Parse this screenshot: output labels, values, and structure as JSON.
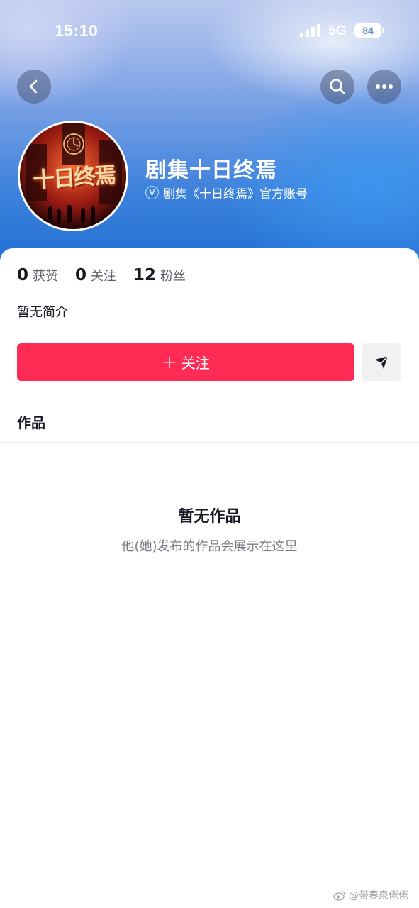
{
  "status_bar": {
    "time": "15:10",
    "network": "5G",
    "battery": "84"
  },
  "header": {
    "back_icon": "chevron-left-icon",
    "search_icon": "search-icon",
    "more_icon": "more-horizontal-icon"
  },
  "profile": {
    "avatar_text": "十日终焉",
    "name": "剧集十日终焉",
    "verified_badge": "V",
    "verified_label": "剧集《十日终焉》官方账号"
  },
  "stats": [
    {
      "value": "0",
      "label": "获赞"
    },
    {
      "value": "0",
      "label": "关注"
    },
    {
      "value": "12",
      "label": "粉丝"
    }
  ],
  "bio": "暂无简介",
  "actions": {
    "follow_plus": "+",
    "follow_label": "关注",
    "message_icon": "send-icon"
  },
  "tabs": {
    "works": "作品"
  },
  "empty_state": {
    "title": "暂无作品",
    "subtitle": "他(她)发布的作品会展示在这里"
  },
  "watermark": "@带春泉佬佬",
  "colors": {
    "accent": "#fe2c55",
    "header_blue": "#1f6fd3"
  }
}
